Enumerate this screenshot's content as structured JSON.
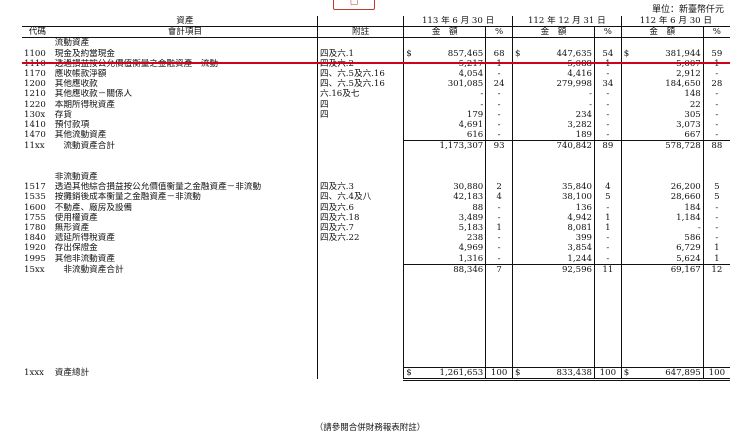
{
  "unit_label": "單位：新臺幣仟元",
  "logo_text": "",
  "header": {
    "assets": "資產",
    "code": "代碼",
    "item": "會計項目",
    "note": "附註",
    "periods": [
      "113 年 6 月 30 日",
      "112 年 12 月 31 日",
      "112 年 6 月 30 日"
    ],
    "amount": "金　額",
    "percent": "%"
  },
  "rows": [
    {
      "code": "",
      "item": "流動資產",
      "note": "",
      "a": "",
      "ap": "",
      "b": "",
      "bp": "",
      "c": "",
      "cp": "",
      "type": "section"
    },
    {
      "code": "1100",
      "item": "現金及約當現金",
      "note": "四及六.1",
      "a": "857,465",
      "ap": "68",
      "b": "447,635",
      "bp": "54",
      "c": "381,944",
      "cp": "59",
      "type": "first"
    },
    {
      "code": "1110",
      "item": "透過損益按公允價值衡量之金融資產－流動",
      "note": "四及六.2",
      "a": "5,217",
      "ap": "1",
      "b": "5,088",
      "bp": "1",
      "c": "5,007",
      "cp": "1"
    },
    {
      "code": "1170",
      "item": "應收帳款淨額",
      "note": "四、六.5及六.16",
      "a": "4,054",
      "ap": "-",
      "b": "4,416",
      "bp": "-",
      "c": "2,912",
      "cp": "-"
    },
    {
      "code": "1200",
      "item": "其他應收款",
      "note": "四、六.5及六.16",
      "a": "301,085",
      "ap": "24",
      "b": "279,998",
      "bp": "34",
      "c": "184,650",
      "cp": "28"
    },
    {
      "code": "1210",
      "item": "其他應收款－關係人",
      "note": "六.16及七",
      "a": "-",
      "ap": "-",
      "b": "-",
      "bp": "-",
      "c": "148",
      "cp": "-"
    },
    {
      "code": "1220",
      "item": "本期所得稅資產",
      "note": "四",
      "a": "-",
      "ap": "-",
      "b": "-",
      "bp": "-",
      "c": "22",
      "cp": "-"
    },
    {
      "code": "130x",
      "item": "存貨",
      "note": "四",
      "a": "179",
      "ap": "-",
      "b": "234",
      "bp": "-",
      "c": "305",
      "cp": "-"
    },
    {
      "code": "1410",
      "item": "預付款項",
      "note": "",
      "a": "4,691",
      "ap": "-",
      "b": "3,282",
      "bp": "-",
      "c": "3,073",
      "cp": "-"
    },
    {
      "code": "1470",
      "item": "其他流動資產",
      "note": "",
      "a": "616",
      "ap": "-",
      "b": "189",
      "bp": "-",
      "c": "667",
      "cp": "-"
    },
    {
      "code": "11xx",
      "item": "　流動資產合計",
      "note": "",
      "a": "1,173,307",
      "ap": "93",
      "b": "740,842",
      "bp": "89",
      "c": "578,728",
      "cp": "88",
      "type": "sub"
    },
    {
      "code": "",
      "item": "",
      "note": "",
      "a": "",
      "ap": "",
      "b": "",
      "bp": "",
      "c": "",
      "cp": "",
      "type": "blank"
    },
    {
      "code": "",
      "item": "",
      "note": "",
      "a": "",
      "ap": "",
      "b": "",
      "bp": "",
      "c": "",
      "cp": "",
      "type": "blank"
    },
    {
      "code": "",
      "item": "非流動資產",
      "note": "",
      "a": "",
      "ap": "",
      "b": "",
      "bp": "",
      "c": "",
      "cp": "",
      "type": "section"
    },
    {
      "code": "1517",
      "item": "透過其他綜合損益按公允價值衡量之金融資產－非流動",
      "note": "四及六.3",
      "a": "30,880",
      "ap": "2",
      "b": "35,840",
      "bp": "4",
      "c": "26,200",
      "cp": "5"
    },
    {
      "code": "1535",
      "item": "按攤銷後成本衡量之金融資產－非流動",
      "note": "四、六.4及八",
      "a": "42,183",
      "ap": "4",
      "b": "38,100",
      "bp": "5",
      "c": "28,660",
      "cp": "5"
    },
    {
      "code": "1600",
      "item": "不動產、廠房及設備",
      "note": "四及六.6",
      "a": "88",
      "ap": "-",
      "b": "136",
      "bp": "-",
      "c": "184",
      "cp": "-"
    },
    {
      "code": "1755",
      "item": "使用權資產",
      "note": "四及六.18",
      "a": "3,489",
      "ap": "-",
      "b": "4,942",
      "bp": "1",
      "c": "1,184",
      "cp": "-"
    },
    {
      "code": "1780",
      "item": "無形資產",
      "note": "四及六.7",
      "a": "5,183",
      "ap": "1",
      "b": "8,081",
      "bp": "1",
      "c": "-",
      "cp": "-"
    },
    {
      "code": "1840",
      "item": "遞延所得稅資產",
      "note": "四及六.22",
      "a": "238",
      "ap": "-",
      "b": "399",
      "bp": "-",
      "c": "586",
      "cp": "-"
    },
    {
      "code": "1920",
      "item": "存出保證金",
      "note": "",
      "a": "4,969",
      "ap": "-",
      "b": "3,854",
      "bp": "-",
      "c": "6,729",
      "cp": "1"
    },
    {
      "code": "1995",
      "item": "其他非流動資產",
      "note": "",
      "a": "1,316",
      "ap": "-",
      "b": "1,244",
      "bp": "-",
      "c": "5,624",
      "cp": "1"
    },
    {
      "code": "15xx",
      "item": "　非流動資產合計",
      "note": "",
      "a": "88,346",
      "ap": "7",
      "b": "92,596",
      "bp": "11",
      "c": "69,167",
      "cp": "12",
      "type": "sub"
    },
    {
      "code": "",
      "item": "",
      "note": "",
      "a": "",
      "ap": "",
      "b": "",
      "bp": "",
      "c": "",
      "cp": "",
      "type": "blank"
    },
    {
      "code": "",
      "item": "",
      "note": "",
      "a": "",
      "ap": "",
      "b": "",
      "bp": "",
      "c": "",
      "cp": "",
      "type": "blank"
    },
    {
      "code": "",
      "item": "",
      "note": "",
      "a": "",
      "ap": "",
      "b": "",
      "bp": "",
      "c": "",
      "cp": "",
      "type": "blank"
    },
    {
      "code": "",
      "item": "",
      "note": "",
      "a": "",
      "ap": "",
      "b": "",
      "bp": "",
      "c": "",
      "cp": "",
      "type": "blank"
    },
    {
      "code": "",
      "item": "",
      "note": "",
      "a": "",
      "ap": "",
      "b": "",
      "bp": "",
      "c": "",
      "cp": "",
      "type": "blank"
    },
    {
      "code": "",
      "item": "",
      "note": "",
      "a": "",
      "ap": "",
      "b": "",
      "bp": "",
      "c": "",
      "cp": "",
      "type": "blank"
    },
    {
      "code": "",
      "item": "",
      "note": "",
      "a": "",
      "ap": "",
      "b": "",
      "bp": "",
      "c": "",
      "cp": "",
      "type": "blank"
    },
    {
      "code": "",
      "item": "",
      "note": "",
      "a": "",
      "ap": "",
      "b": "",
      "bp": "",
      "c": "",
      "cp": "",
      "type": "blank"
    },
    {
      "code": "",
      "item": "",
      "note": "",
      "a": "",
      "ap": "",
      "b": "",
      "bp": "",
      "c": "",
      "cp": "",
      "type": "blank"
    },
    {
      "code": "1xxx",
      "item": "資產總計",
      "note": "",
      "a": "1,261,653",
      "ap": "100",
      "b": "833,438",
      "bp": "100",
      "c": "647,895",
      "cp": "100",
      "type": "total"
    }
  ],
  "footer": "（請參閱合併財務報表附註）",
  "colors": {
    "highlight_line": "#d0021b"
  }
}
